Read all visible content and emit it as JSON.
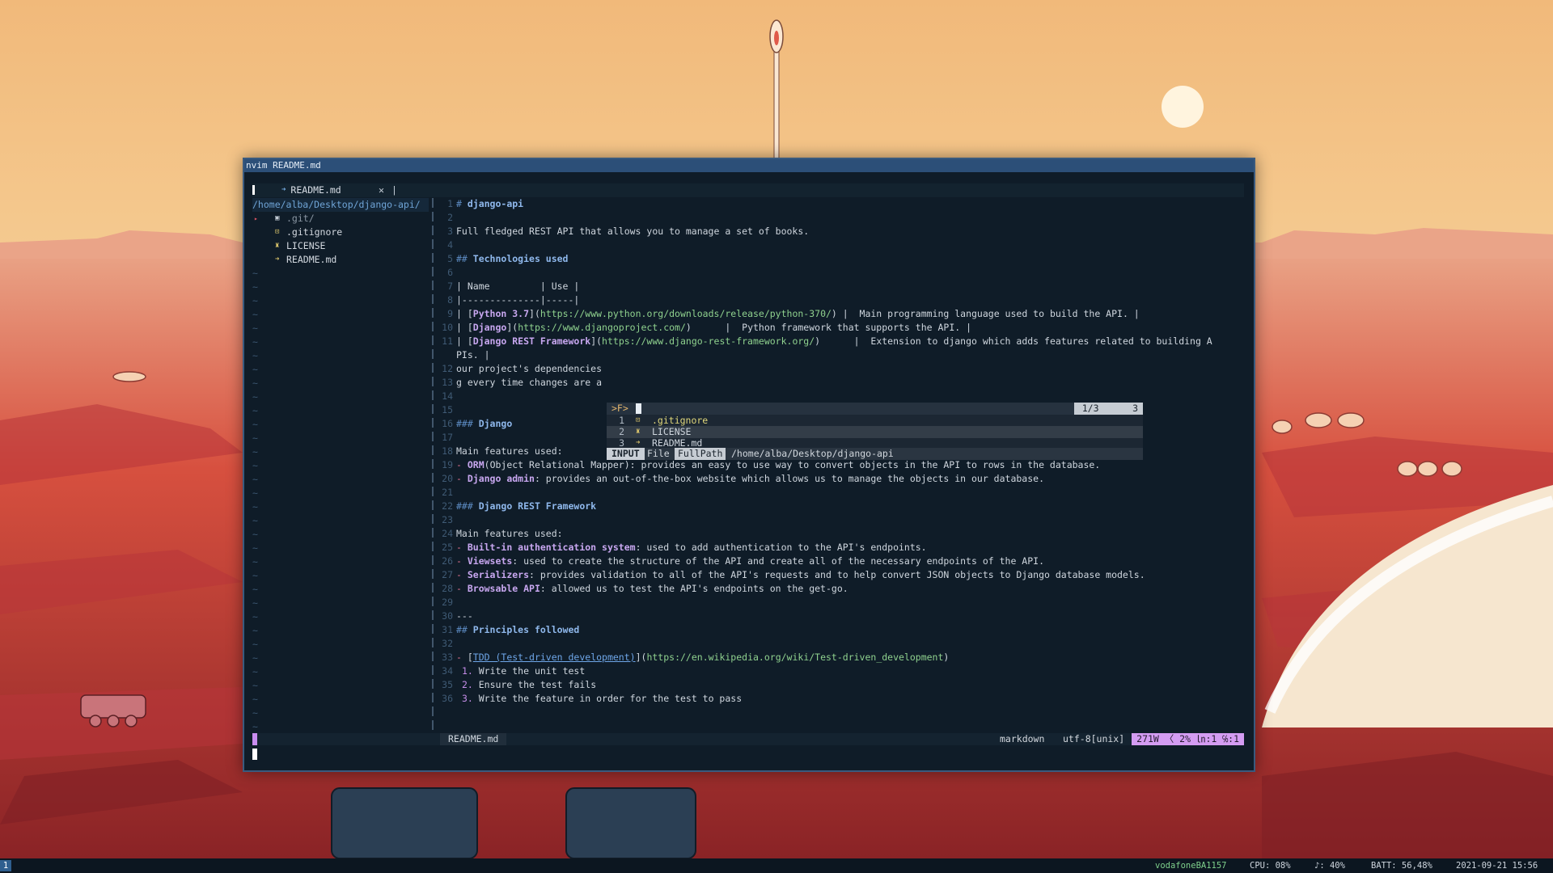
{
  "window": {
    "title": "nvim README.md"
  },
  "tabline": {
    "tab_label": "README.md",
    "close_glyph": "✕",
    "sep": "|"
  },
  "tree": {
    "root": "/home/alba/Desktop/django-api/",
    "items": [
      {
        "name": ".git/",
        "icon": "git-folder-icon",
        "color": "#8a96a3"
      },
      {
        "name": ".gitignore",
        "icon": "git-icon",
        "color": "#d3d9e0"
      },
      {
        "name": "LICENSE",
        "icon": "license-icon",
        "color": "#d3d9e0"
      },
      {
        "name": "README.md",
        "icon": "markdown-icon",
        "color": "#d3d9e0"
      }
    ]
  },
  "editor": {
    "lines": [
      {
        "n": "1",
        "t": "# django-api"
      },
      {
        "n": "2",
        "t": ""
      },
      {
        "n": "3",
        "t": "Full fledged REST API that allows you to manage a set of books."
      },
      {
        "n": "4",
        "t": ""
      },
      {
        "n": "5",
        "t": "## Technologies used"
      },
      {
        "n": "6",
        "t": ""
      },
      {
        "n": "7",
        "t": "| Name         | Use |"
      },
      {
        "n": "8",
        "t": "|--------------|-----|"
      },
      {
        "n": "9",
        "t": "| [Python 3.7](https://www.python.org/downloads/release/python-370/) |  Main programming language used to build the API. |"
      },
      {
        "n": "10",
        "t": "| [Django](https://www.djangoproject.com/)      |  Python framework that supports the API. |"
      },
      {
        "n": "11",
        "t": "| [Django REST Framework](https://www.django-rest-framework.org/)      |  Extension to django which adds features related to building A"
      },
      {
        "n": "",
        "t": "PIs. |"
      },
      {
        "n": "12",
        "t": "our project's dependencies"
      },
      {
        "n": "13",
        "t": "g every time changes are a"
      },
      {
        "n": "14",
        "t": ""
      },
      {
        "n": "15",
        "t": ""
      },
      {
        "n": "16",
        "t": "### Django"
      },
      {
        "n": "17",
        "t": ""
      },
      {
        "n": "18",
        "t": "Main features used:"
      },
      {
        "n": "19",
        "t": "- ORM(Object Relational Mapper): provides an easy to use way to convert objects in the API to rows in the database."
      },
      {
        "n": "20",
        "t": "- Django admin: provides an out-of-the-box website which allows us to manage the objects in our database."
      },
      {
        "n": "21",
        "t": ""
      },
      {
        "n": "22",
        "t": "### Django REST Framework"
      },
      {
        "n": "23",
        "t": ""
      },
      {
        "n": "24",
        "t": "Main features used:"
      },
      {
        "n": "25",
        "t": "- Built-in authentication system: used to add authentication to the API's endpoints."
      },
      {
        "n": "26",
        "t": "- Viewsets: used to create the structure of the API and create all of the necessary endpoints of the API."
      },
      {
        "n": "27",
        "t": "- Serializers: provides validation to all of the API's requests and to help convert JSON objects to Django database models."
      },
      {
        "n": "28",
        "t": "- Browsable API: allowed us to test the API's endpoints on the get-go."
      },
      {
        "n": "29",
        "t": ""
      },
      {
        "n": "30",
        "t": "---"
      },
      {
        "n": "31",
        "t": "## Principles followed"
      },
      {
        "n": "32",
        "t": ""
      },
      {
        "n": "33",
        "t": "- [TDD (Test-driven development)](https://en.wikipedia.org/wiki/Test-driven_development)"
      },
      {
        "n": "34",
        "t": " 1. Write the unit test"
      },
      {
        "n": "35",
        "t": " 2. Ensure the test fails"
      },
      {
        "n": "36",
        "t": " 3. Write the feature in order for the test to pass"
      }
    ]
  },
  "finder": {
    "prompt": ">F>",
    "count": "1/3",
    "total": "3",
    "results": [
      {
        "n": "1",
        "name": ".gitignore",
        "icon": "git-icon",
        "color": "#e0d77a"
      },
      {
        "n": "2",
        "name": "LICENSE",
        "icon": "license-icon",
        "color": "#d3d9e0"
      },
      {
        "n": "3",
        "name": "README.md",
        "icon": "markdown-icon",
        "color": "#d3d9e0"
      }
    ],
    "status": {
      "mode": "INPUT",
      "file": "File",
      "fullpath": "FullPath",
      "path": "/home/alba/Desktop/django-api"
    }
  },
  "statusline": {
    "file": "README.md",
    "filetype": "markdown",
    "encoding": "utf-8[unix]",
    "position": "271W 〈 2% ㏑:1 ℅:1"
  },
  "bar": {
    "workspace": "1",
    "wifi": "vodafoneBA1157",
    "cpu": "CPU: 08%",
    "volume": "♪: 40%",
    "battery": "BATT: 56,48%",
    "datetime": "2021-09-21 15:56"
  }
}
